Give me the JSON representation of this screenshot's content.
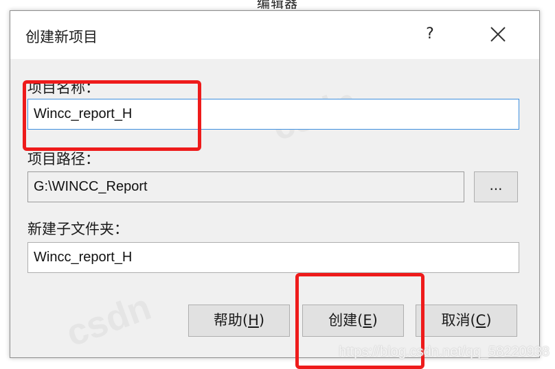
{
  "background_title": "编辑器",
  "dialog": {
    "title": "创建新项目",
    "help_label": "?",
    "close_icon": "close-icon"
  },
  "form": {
    "project_name_label": "项目名称：",
    "project_name_value": "Wincc_report_H",
    "project_path_label": "项目路径：",
    "project_path_value": "G:\\WINCC_Report",
    "browse_label": "...",
    "subfolder_label": "新建子文件夹：",
    "subfolder_value": "Wincc_report_H"
  },
  "buttons": {
    "help": "帮助",
    "help_key": "H",
    "create": "创建",
    "create_key": "E",
    "cancel": "取消",
    "cancel_key": "C"
  },
  "watermark": "https://blog.csdn.net/qq_58220938",
  "colors": {
    "highlight": "#ee1b1b",
    "focus_border": "#3c8ede",
    "dialog_bg": "#f0f0f0"
  }
}
